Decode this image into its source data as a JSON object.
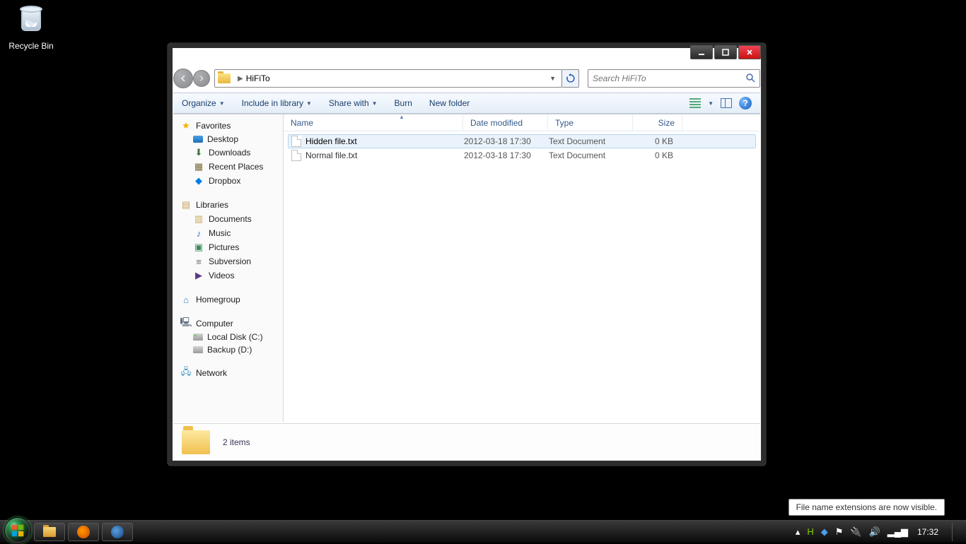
{
  "desktop": {
    "recycle_bin_label": "Recycle Bin"
  },
  "window": {
    "nav": {
      "path": "HiFiTo",
      "search_placeholder": "Search HiFiTo"
    },
    "toolbar": {
      "organize": "Organize",
      "include": "Include in library",
      "share": "Share with",
      "burn": "Burn",
      "newfolder": "New folder"
    },
    "sidebar": {
      "favorites_head": "Favorites",
      "favorites": [
        {
          "icon": "desktop",
          "label": "Desktop"
        },
        {
          "icon": "downloads",
          "label": "Downloads"
        },
        {
          "icon": "recent",
          "label": "Recent Places"
        },
        {
          "icon": "dropbox",
          "label": "Dropbox"
        }
      ],
      "libraries_head": "Libraries",
      "libraries": [
        {
          "icon": "documents",
          "label": "Documents"
        },
        {
          "icon": "music",
          "label": "Music"
        },
        {
          "icon": "pictures",
          "label": "Pictures"
        },
        {
          "icon": "subversion",
          "label": "Subversion"
        },
        {
          "icon": "videos",
          "label": "Videos"
        }
      ],
      "homegroup_head": "Homegroup",
      "computer_head": "Computer",
      "drives": [
        {
          "icon": "localdisk",
          "label": "Local Disk (C:)"
        },
        {
          "icon": "backup",
          "label": "Backup (D:)"
        }
      ],
      "network_head": "Network"
    },
    "columns": {
      "name": "Name",
      "date": "Date modified",
      "type": "Type",
      "size": "Size"
    },
    "files": [
      {
        "name": "Hidden file.txt",
        "date": "2012-03-18 17:30",
        "type": "Text Document",
        "size": "0 KB",
        "selected": true
      },
      {
        "name": "Normal file.txt",
        "date": "2012-03-18 17:30",
        "type": "Text Document",
        "size": "0 KB",
        "selected": false
      }
    ],
    "status": {
      "count_text": "2 items"
    }
  },
  "tooltip": {
    "text": "File name extensions are now visible."
  },
  "taskbar": {
    "clock": "17:32"
  }
}
